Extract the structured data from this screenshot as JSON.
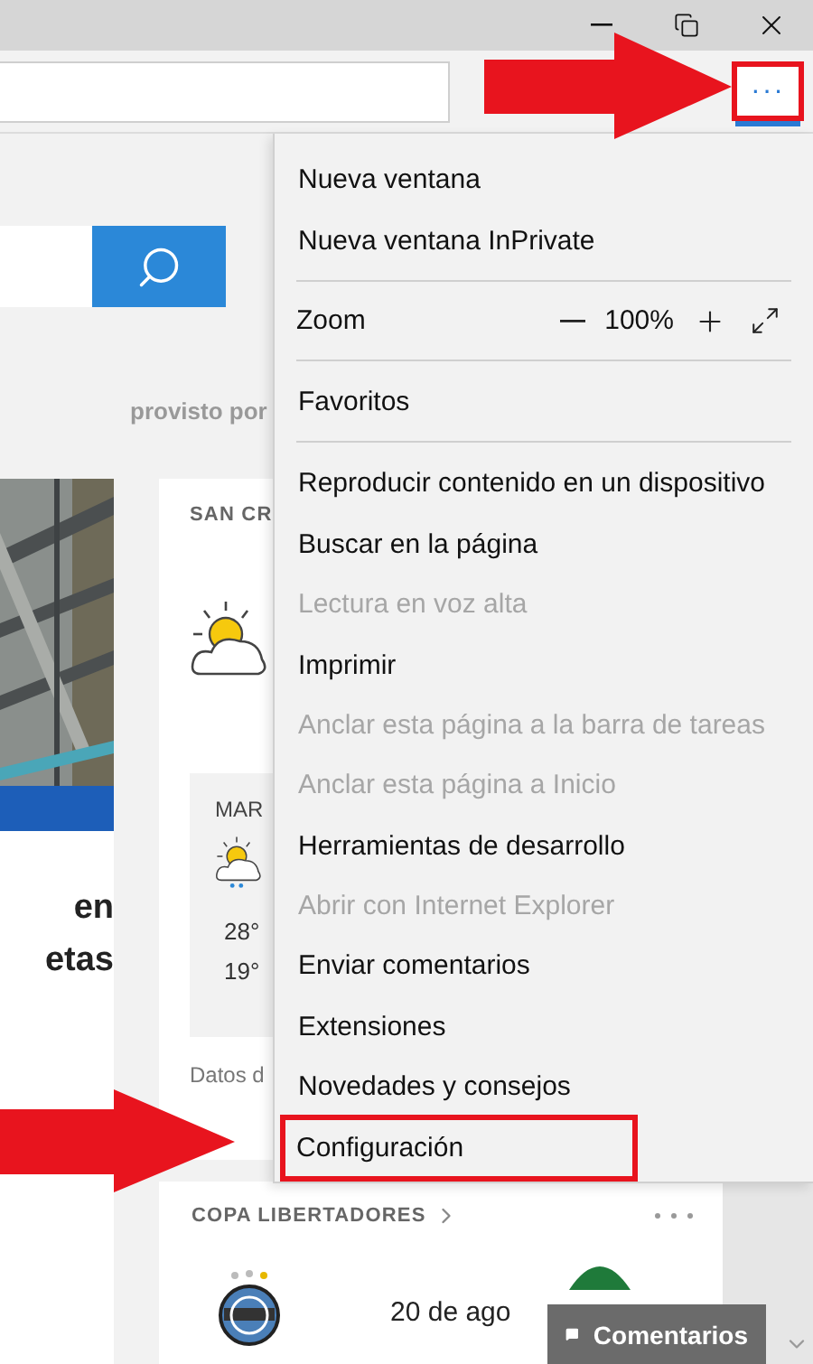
{
  "toolbar": {
    "more_button": {
      "label": "···",
      "marked": true
    }
  },
  "page": {
    "provider_text": "provisto por",
    "news_card": {
      "headline_lines": [
        "en",
        "etas"
      ]
    },
    "weather_card": {
      "location": "SAN CR",
      "forecast": {
        "day": "MAR",
        "high": "28°",
        "low": "19°"
      },
      "source": "Datos d"
    },
    "sports_card": {
      "title": "COPA LIBERTADORES",
      "match_date": "20 de ago"
    },
    "feedback_button": "Comentarios"
  },
  "menu": {
    "items": [
      {
        "kind": "item",
        "label": "Nueva ventana",
        "disabled": false,
        "marked": false
      },
      {
        "kind": "item",
        "label": "Nueva ventana InPrivate",
        "disabled": false,
        "marked": false
      },
      {
        "kind": "separator"
      },
      {
        "kind": "zoom",
        "label": "Zoom",
        "value": "100%"
      },
      {
        "kind": "separator"
      },
      {
        "kind": "item",
        "label": "Favoritos",
        "disabled": false,
        "marked": false
      },
      {
        "kind": "separator"
      },
      {
        "kind": "item",
        "label": "Reproducir contenido en un dispositivo",
        "disabled": false,
        "marked": false
      },
      {
        "kind": "item",
        "label": "Buscar en la página",
        "disabled": false,
        "marked": false
      },
      {
        "kind": "item",
        "label": "Lectura en voz alta",
        "disabled": true,
        "marked": false
      },
      {
        "kind": "item",
        "label": "Imprimir",
        "disabled": false,
        "marked": false
      },
      {
        "kind": "item",
        "label": "Anclar esta página a la barra de tareas",
        "disabled": true,
        "marked": false
      },
      {
        "kind": "item",
        "label": "Anclar esta página a Inicio",
        "disabled": true,
        "marked": false
      },
      {
        "kind": "item",
        "label": "Herramientas de desarrollo",
        "disabled": false,
        "marked": false
      },
      {
        "kind": "item",
        "label": "Abrir con Internet Explorer",
        "disabled": true,
        "marked": false
      },
      {
        "kind": "item",
        "label": "Enviar comentarios",
        "disabled": false,
        "marked": false
      },
      {
        "kind": "item",
        "label": "Extensiones",
        "disabled": false,
        "marked": false
      },
      {
        "kind": "item",
        "label": "Novedades y consejos",
        "disabled": false,
        "marked": false
      },
      {
        "kind": "item",
        "label": "Configuración",
        "disabled": false,
        "marked": true
      }
    ]
  }
}
